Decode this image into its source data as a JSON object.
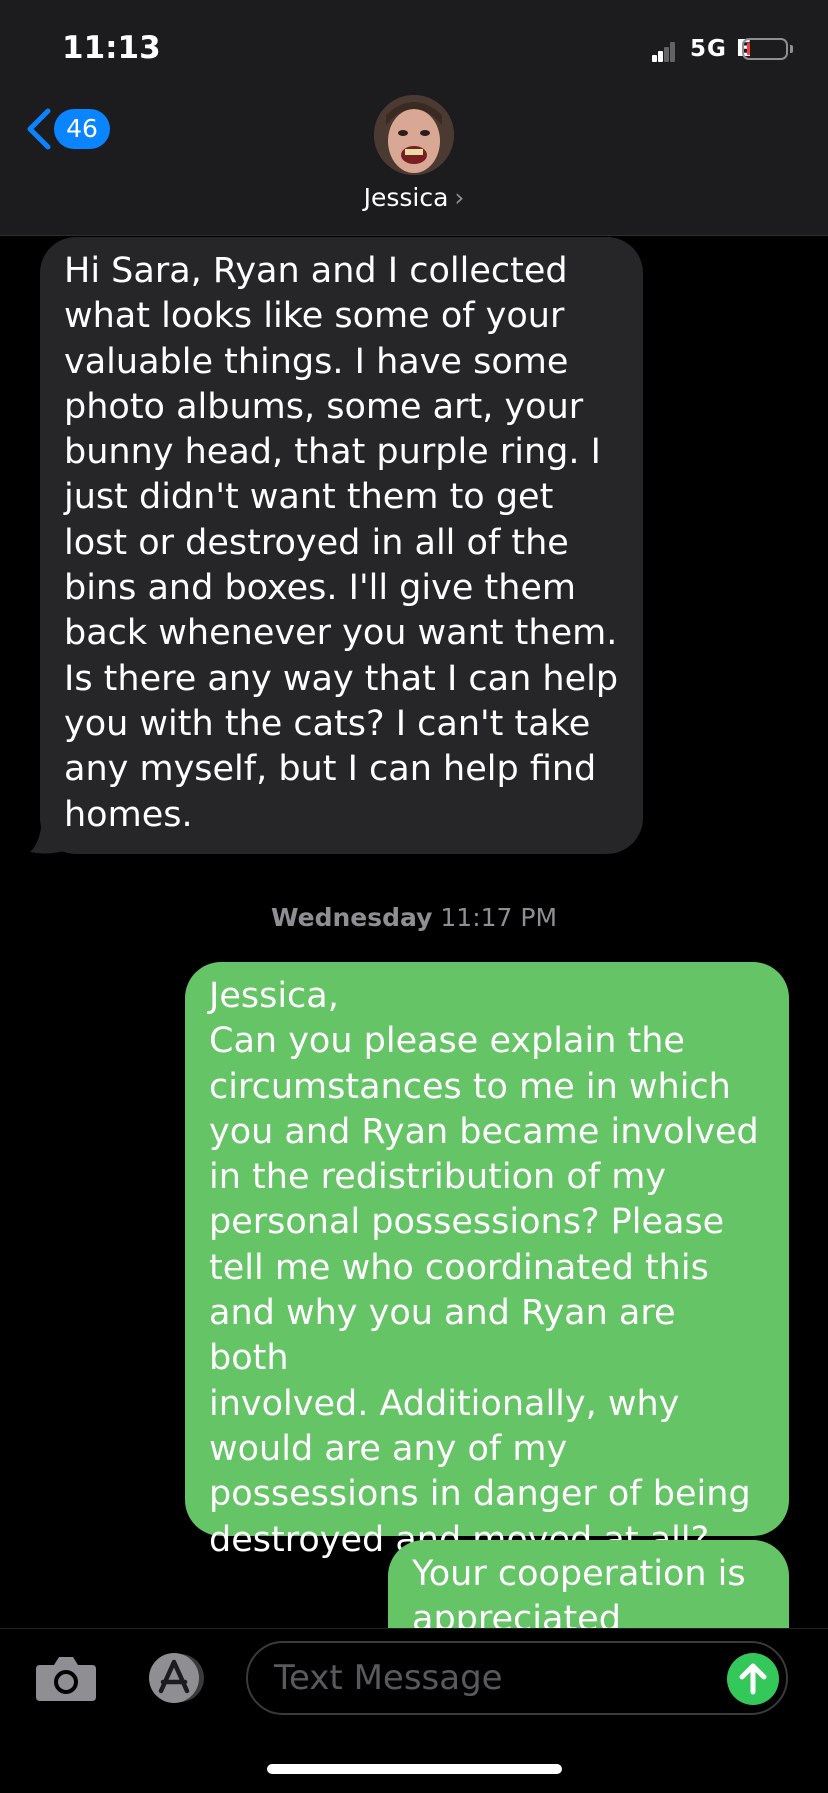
{
  "status_bar": {
    "time": "11:13",
    "network": "5G E"
  },
  "nav": {
    "back_count": "46",
    "contact_name": "Jessica",
    "contact_chevron": "›"
  },
  "messages": [
    {
      "direction": "incoming",
      "text": "Hi Sara, Ryan and I collected\nwhat looks like some of your\nvaluable things. I have some\nphoto albums, some art, your\nbunny head, that purple ring. I\njust didn't want them to get\nlost or destroyed in all of the\nbins and boxes. I'll give them\nback whenever you want them.\nIs there any way that I can help\nyou with the cats? I can't take\nany myself, but I can help find\nhomes."
    },
    {
      "direction": "outgoing",
      "text": "Jessica,\nCan you please explain the\ncircumstances to me in which\nyou and Ryan became involved\nin the redistribution of my\npersonal possessions? Please\ntell me who coordinated this\nand why you and Ryan are both\ninvolved. Additionally, why\nwould are any of my\npossessions in danger of being\ndestroyed and moved at all?"
    },
    {
      "direction": "outgoing",
      "text": "Your cooperation is\nappreciated"
    }
  ],
  "timestamp": {
    "day": "Wednesday",
    "time": "11:17 PM"
  },
  "composer": {
    "placeholder": "Text Message"
  },
  "colors": {
    "incoming_bubble": "#262629",
    "outgoing_bubble": "#65c466",
    "accent": "#0a84ff",
    "send": "#34c759"
  },
  "icons": [
    "chevron-left-icon",
    "camera-icon",
    "app-store-icon",
    "send-arrow-icon",
    "signal-icon",
    "battery-icon"
  ]
}
